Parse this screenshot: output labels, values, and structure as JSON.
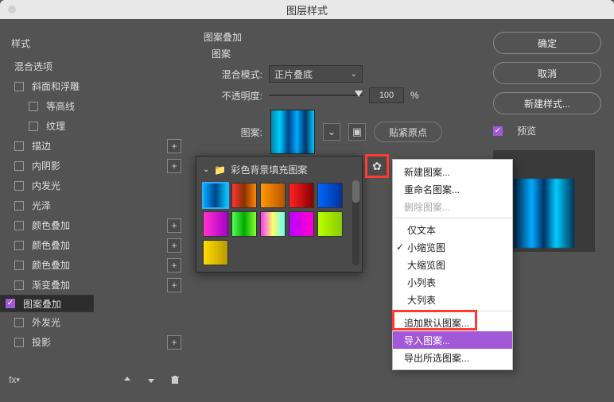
{
  "title": "图层样式",
  "left": {
    "header": "样式",
    "blending": "混合选项",
    "items": [
      {
        "label": "斜面和浮雕",
        "checked": false,
        "plus": false,
        "sub": false
      },
      {
        "label": "等高线",
        "checked": false,
        "plus": false,
        "sub": true
      },
      {
        "label": "纹理",
        "checked": false,
        "plus": false,
        "sub": true
      },
      {
        "label": "描边",
        "checked": false,
        "plus": true,
        "sub": false
      },
      {
        "label": "内阴影",
        "checked": false,
        "plus": true,
        "sub": false
      },
      {
        "label": "内发光",
        "checked": false,
        "plus": false,
        "sub": false
      },
      {
        "label": "光泽",
        "checked": false,
        "plus": false,
        "sub": false
      },
      {
        "label": "颜色叠加",
        "checked": false,
        "plus": true,
        "sub": false
      },
      {
        "label": "颜色叠加",
        "checked": false,
        "plus": true,
        "sub": false
      },
      {
        "label": "颜色叠加",
        "checked": false,
        "plus": true,
        "sub": false
      },
      {
        "label": "渐变叠加",
        "checked": false,
        "plus": true,
        "sub": false
      },
      {
        "label": "图案叠加",
        "checked": true,
        "plus": false,
        "sub": false,
        "selected": true
      },
      {
        "label": "外发光",
        "checked": false,
        "plus": false,
        "sub": false
      },
      {
        "label": "投影",
        "checked": false,
        "plus": true,
        "sub": false
      }
    ],
    "fx_label": "fx"
  },
  "mid": {
    "section_title": "图案叠加",
    "fieldset_label": "图案",
    "blend_mode_label": "混合模式:",
    "blend_mode_value": "正片叠底",
    "opacity_label": "不透明度:",
    "opacity_value": "100",
    "opacity_unit": "%",
    "pattern_label": "图案:",
    "snap_label": "贴紧原点"
  },
  "right": {
    "ok": "确定",
    "cancel": "取消",
    "newstyle": "新建样式...",
    "preview": "预览"
  },
  "picker": {
    "folder": "彩色背景填充图案"
  },
  "menu": {
    "new": "新建图案...",
    "rename": "重命名图案...",
    "delete": "删除图案...",
    "text_only": "仅文本",
    "thumb_small": "小缩览图",
    "thumb_large": "大缩览图",
    "list_small": "小列表",
    "list_large": "大列表",
    "append_default": "追加默认图案...",
    "import": "导入图案...",
    "export": "导出所选图案..."
  }
}
